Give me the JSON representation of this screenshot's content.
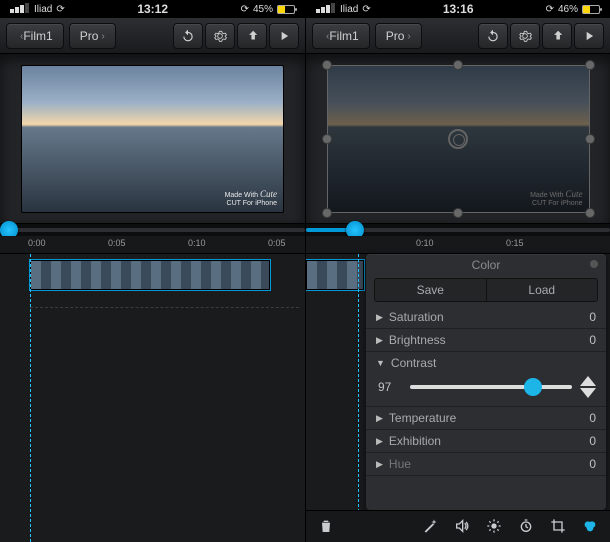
{
  "left_pane": {
    "status": {
      "carrier": "Iliad",
      "time": "13:12",
      "battery_pct": "45%",
      "spinner": true
    },
    "toolbar": {
      "back_label": "Film1",
      "back_chevron": "‹",
      "pro_label": "Pro",
      "pro_chevron": "›"
    },
    "toolbar_icons": [
      "undo",
      "gear",
      "share",
      "play"
    ],
    "preview_watermark": {
      "line1": "Made With",
      "brand": "Cute",
      "cut": "CUT",
      "line2": "For iPhone"
    },
    "scrubber": {
      "position_pct": 3
    },
    "ruler_ticks": [
      "0:00",
      "0:05",
      "0:10",
      "0:05"
    ],
    "side_buttons": [
      "aperture",
      "plus"
    ],
    "clip": {
      "start_pct": 10,
      "width_pct": 78
    },
    "playhead_pct": 7
  },
  "right_pane": {
    "status": {
      "carrier": "Iliad",
      "time": "13:16",
      "battery_pct": "46%",
      "spinner": true
    },
    "toolbar": {
      "back_label": "Film1",
      "back_chevron": "‹",
      "pro_label": "Pro",
      "pro_chevron": "›"
    },
    "toolbar_icons": [
      "undo",
      "gear",
      "share",
      "play"
    ],
    "preview_watermark": {
      "line1": "Made With",
      "brand": "Cute",
      "cut": "CUT",
      "line2": "For iPhone"
    },
    "scrubber": {
      "position_pct": 16
    },
    "ruler_ticks": [
      "0:10",
      "0:15"
    ],
    "panel": {
      "title": "Color",
      "seg_left": "Save",
      "seg_right": "Load",
      "rows": [
        {
          "label": "Saturation",
          "value": "0",
          "expanded": false
        },
        {
          "label": "Brightness",
          "value": "0",
          "expanded": false
        },
        {
          "label": "Contrast",
          "value": "97",
          "expanded": true,
          "slider_pct": 76
        },
        {
          "label": "Temperature",
          "value": "0",
          "expanded": false
        },
        {
          "label": "Exhibition",
          "value": "0",
          "expanded": false
        },
        {
          "label": "Hue",
          "value": "0",
          "expanded": false,
          "dim": true
        }
      ]
    },
    "playhead_pct": 16,
    "bottom_icons": [
      "trash",
      "wand",
      "volume",
      "brightness",
      "timer",
      "crop",
      "color"
    ]
  }
}
